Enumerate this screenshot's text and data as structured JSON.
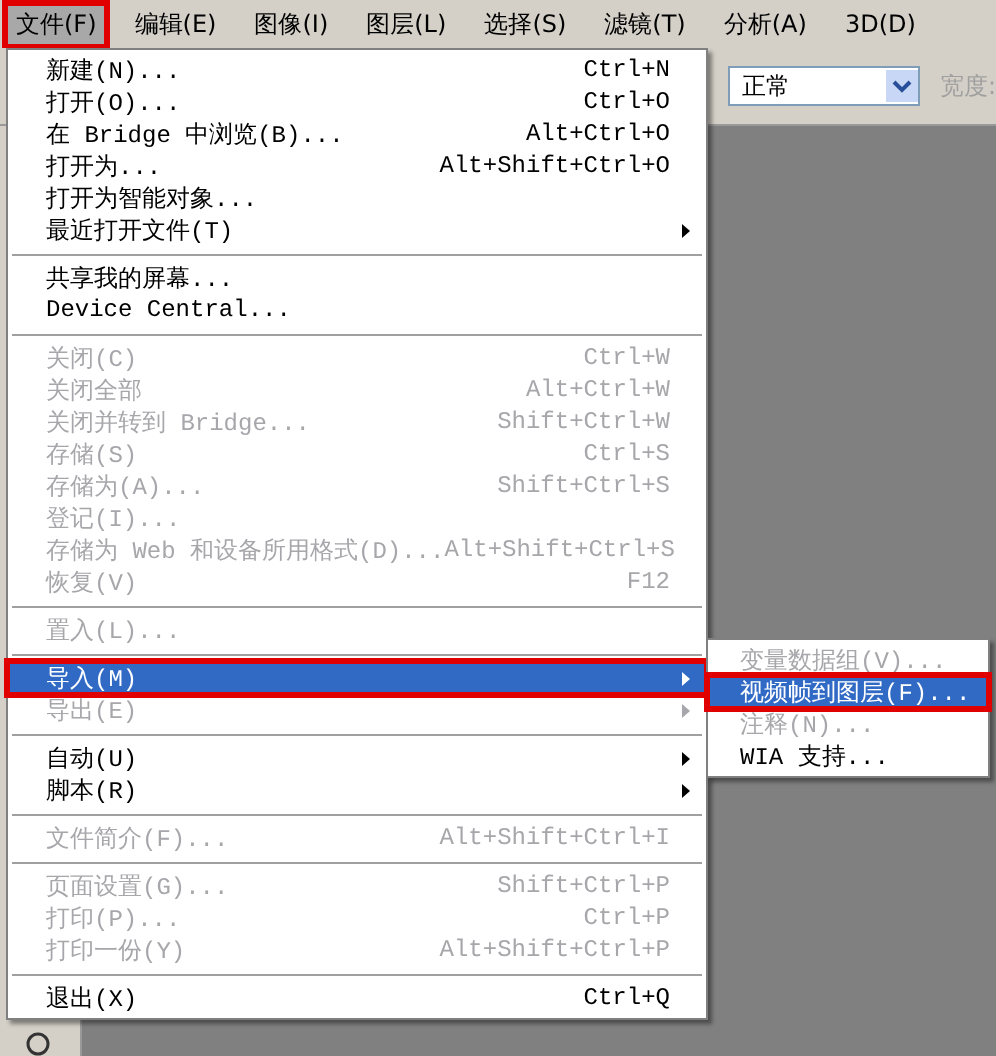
{
  "menubar": [
    {
      "label": "文件(F)",
      "selected": true,
      "marked": true
    },
    {
      "label": "编辑(E)",
      "selected": false,
      "marked": false
    },
    {
      "label": "图像(I)",
      "selected": false,
      "marked": false
    },
    {
      "label": "图层(L)",
      "selected": false,
      "marked": false
    },
    {
      "label": "选择(S)",
      "selected": false,
      "marked": false
    },
    {
      "label": "滤镜(T)",
      "selected": false,
      "marked": false
    },
    {
      "label": "分析(A)",
      "selected": false,
      "marked": false
    },
    {
      "label": "3D(D)",
      "selected": false,
      "marked": false
    }
  ],
  "options_bar": {
    "mode": "正常",
    "label": "宽度:"
  },
  "menu": {
    "groups": [
      {
        "items": [
          {
            "label": "新建(N)...",
            "shortcut": "Ctrl+N",
            "disabled": false,
            "selected": false,
            "submenu": false,
            "marked": false
          },
          {
            "label": "打开(O)...",
            "shortcut": "Ctrl+O",
            "disabled": false,
            "selected": false,
            "submenu": false,
            "marked": false
          },
          {
            "label": "在 Bridge 中浏览(B)...",
            "shortcut": "Alt+Ctrl+O",
            "disabled": false,
            "selected": false,
            "submenu": false,
            "marked": false
          },
          {
            "label": "打开为...",
            "shortcut": "Alt+Shift+Ctrl+O",
            "disabled": false,
            "selected": false,
            "submenu": false,
            "marked": false
          },
          {
            "label": "打开为智能对象...",
            "disabled": false,
            "selected": false,
            "submenu": false,
            "marked": false
          },
          {
            "label": "最近打开文件(T)",
            "disabled": false,
            "selected": false,
            "submenu": true,
            "marked": false
          }
        ]
      },
      {
        "items": [
          {
            "label": "共享我的屏幕...",
            "disabled": false,
            "selected": false,
            "submenu": false,
            "marked": false
          },
          {
            "label": "Device Central...",
            "disabled": false,
            "selected": false,
            "submenu": false,
            "marked": false
          }
        ]
      },
      {
        "items": [
          {
            "label": "关闭(C)",
            "shortcut": "Ctrl+W",
            "disabled": true,
            "selected": false,
            "submenu": false,
            "marked": false
          },
          {
            "label": "关闭全部",
            "shortcut": "Alt+Ctrl+W",
            "disabled": true,
            "selected": false,
            "submenu": false,
            "marked": false
          },
          {
            "label": "关闭并转到 Bridge...",
            "shortcut": "Shift+Ctrl+W",
            "disabled": true,
            "selected": false,
            "submenu": false,
            "marked": false
          },
          {
            "label": "存储(S)",
            "shortcut": "Ctrl+S",
            "disabled": true,
            "selected": false,
            "submenu": false,
            "marked": false
          },
          {
            "label": "存储为(A)...",
            "shortcut": "Shift+Ctrl+S",
            "disabled": true,
            "selected": false,
            "submenu": false,
            "marked": false
          },
          {
            "label": "登记(I)...",
            "disabled": true,
            "selected": false,
            "submenu": false,
            "marked": false
          },
          {
            "label": "存储为 Web 和设备所用格式(D)...",
            "shortcut": "Alt+Shift+Ctrl+S",
            "disabled": true,
            "selected": false,
            "submenu": false,
            "marked": false
          },
          {
            "label": "恢复(V)",
            "shortcut": "F12",
            "disabled": true,
            "selected": false,
            "submenu": false,
            "marked": false
          }
        ]
      },
      {
        "items": [
          {
            "label": "置入(L)...",
            "disabled": true,
            "selected": false,
            "submenu": false,
            "marked": false
          }
        ]
      },
      {
        "items": [
          {
            "label": "导入(M)",
            "disabled": false,
            "selected": true,
            "submenu": true,
            "marked": true,
            "children": [
              {
                "label": "变量数据组(V)...",
                "disabled": true,
                "selected": false,
                "marked": false
              },
              {
                "label": "视频帧到图层(F)...",
                "disabled": false,
                "selected": true,
                "marked": true
              },
              {
                "label": "注释(N)...",
                "disabled": true,
                "selected": false,
                "marked": false
              },
              {
                "label": "WIA 支持...",
                "disabled": false,
                "selected": false,
                "marked": false
              }
            ]
          },
          {
            "label": "导出(E)",
            "disabled": true,
            "selected": false,
            "submenu": true,
            "marked": false
          }
        ]
      },
      {
        "items": [
          {
            "label": "自动(U)",
            "disabled": false,
            "selected": false,
            "submenu": true,
            "marked": false
          },
          {
            "label": "脚本(R)",
            "disabled": false,
            "selected": false,
            "submenu": true,
            "marked": false
          }
        ]
      },
      {
        "items": [
          {
            "label": "文件简介(F)...",
            "shortcut": "Alt+Shift+Ctrl+I",
            "disabled": true,
            "selected": false,
            "submenu": false,
            "marked": false
          }
        ]
      },
      {
        "items": [
          {
            "label": "页面设置(G)...",
            "shortcut": "Shift+Ctrl+P",
            "disabled": true,
            "selected": false,
            "submenu": false,
            "marked": false
          },
          {
            "label": "打印(P)...",
            "shortcut": "Ctrl+P",
            "disabled": true,
            "selected": false,
            "submenu": false,
            "marked": false
          },
          {
            "label": "打印一份(Y)",
            "shortcut": "Alt+Shift+Ctrl+P",
            "disabled": true,
            "selected": false,
            "submenu": false,
            "marked": false
          }
        ]
      },
      {
        "items": [
          {
            "label": "退出(X)",
            "shortcut": "Ctrl+Q",
            "disabled": false,
            "selected": false,
            "submenu": false,
            "marked": false
          }
        ]
      }
    ]
  }
}
